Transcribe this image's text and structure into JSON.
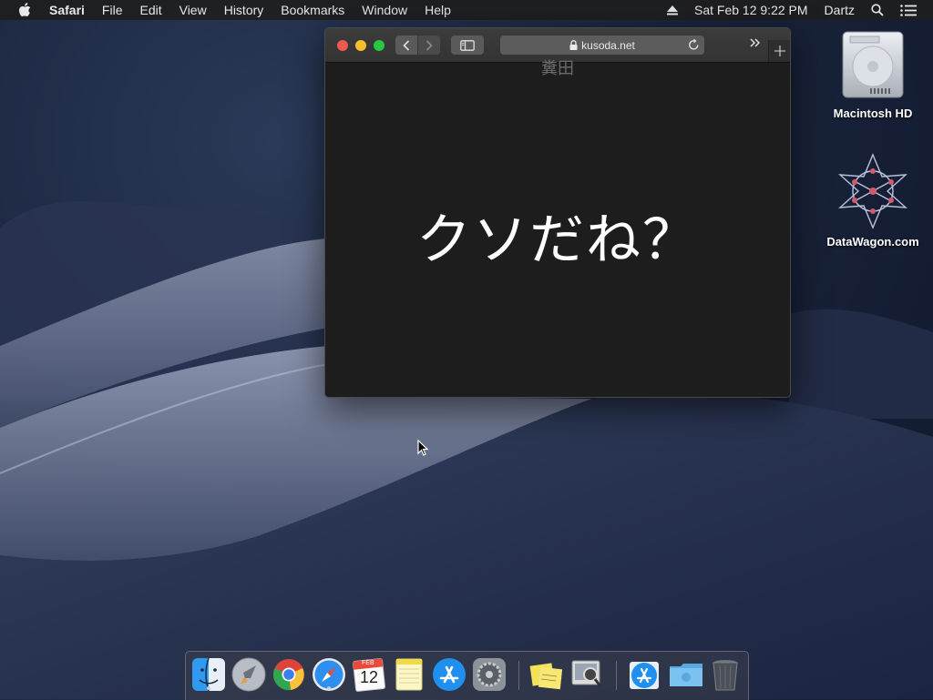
{
  "menubar": {
    "app": "Safari",
    "items": [
      "File",
      "Edit",
      "View",
      "History",
      "Bookmarks",
      "Window",
      "Help"
    ],
    "datetime": "Sat Feb 12  9:22 PM",
    "user": "Dartz",
    "icons": [
      "apple-icon",
      "eject-icon",
      "spotlight-search-icon",
      "notification-center-icon"
    ]
  },
  "browser": {
    "url": "kusoda.net",
    "page": {
      "faded_heading": "糞田",
      "main_text": "クソだね？"
    }
  },
  "desktop": {
    "icons": [
      {
        "label": "Macintosh HD",
        "icon": "hard-drive-icon"
      },
      {
        "label": "DataWagon.com",
        "icon": "datawagon-icon"
      }
    ]
  },
  "dock": {
    "calendar_month": "FEB",
    "calendar_day": "12",
    "items": [
      "finder",
      "launchpad",
      "chrome",
      "safari",
      "calendar",
      "notes",
      "app-store",
      "system-preferences",
      "stickies",
      "preview",
      "app-store-folder",
      "folder",
      "trash"
    ]
  },
  "colors": {
    "menubar": "#1e1e20",
    "window_bg": "#1d1d1d",
    "traffic_red": "#ee5a52",
    "traffic_yellow": "#f5be2f",
    "traffic_green": "#2ac840"
  }
}
